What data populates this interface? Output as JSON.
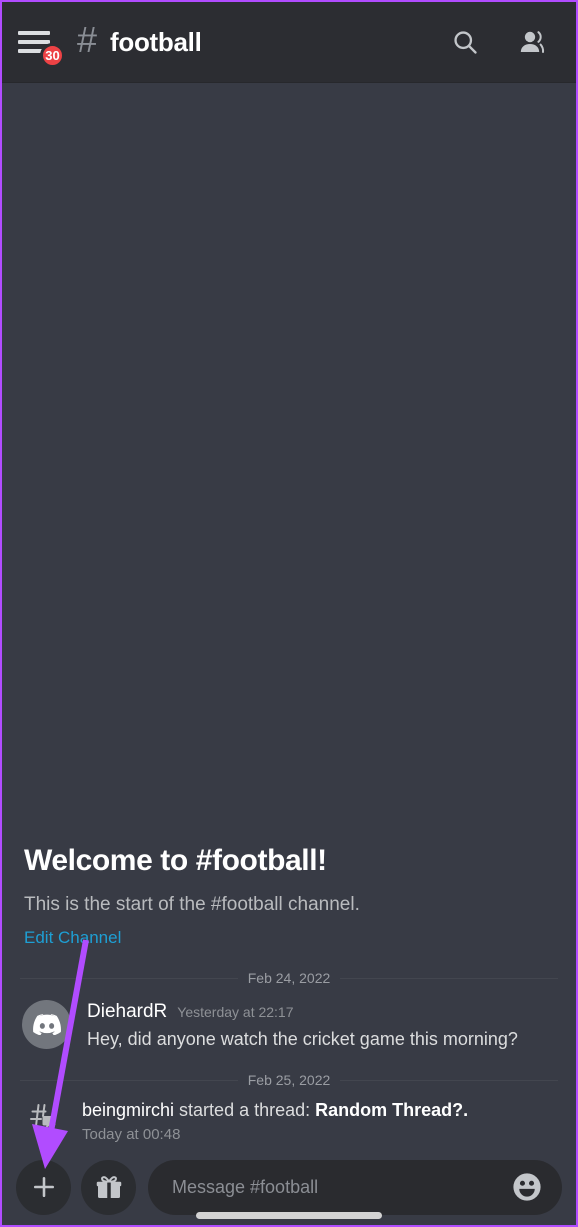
{
  "header": {
    "menu_icon": "hamburger-menu-icon",
    "unread_badge": "30",
    "hash_icon": "#",
    "channel_name": "football",
    "search_icon": "search-icon",
    "members_icon": "members-icon"
  },
  "welcome": {
    "title": "Welcome to #football!",
    "subtitle": "This is the start of the #football channel.",
    "edit_link": "Edit Channel"
  },
  "conversation": [
    {
      "type": "divider",
      "label": "Feb 24, 2022"
    },
    {
      "type": "message",
      "avatar_icon": "discord-logo-avatar",
      "author": "DiehardR",
      "timestamp": "Yesterday at 22:17",
      "text": "Hey, did anyone watch the cricket game this morning?"
    },
    {
      "type": "divider",
      "label": "Feb 25, 2022"
    },
    {
      "type": "thread",
      "icon": "thread-created-icon",
      "author": "beingmirchi",
      "action": " started a thread: ",
      "thread_name": "Random Thread?.",
      "timestamp": "Today at 00:48"
    }
  ],
  "input_bar": {
    "add_button_icon": "plus-icon",
    "gift_button_icon": "gift-icon",
    "placeholder": "Message #football",
    "emoji_icon": "emoji-smiley-icon"
  },
  "annotation": {
    "arrow_color": "#b14cff",
    "points_to": "plus-icon"
  },
  "colors": {
    "app_background": "#383b45",
    "header_background": "#2c2d32",
    "input_background": "#2a2b2f",
    "accent_link": "#1e9fd4",
    "badge_red": "#ed4245",
    "annotation_purple": "#b14cff"
  }
}
